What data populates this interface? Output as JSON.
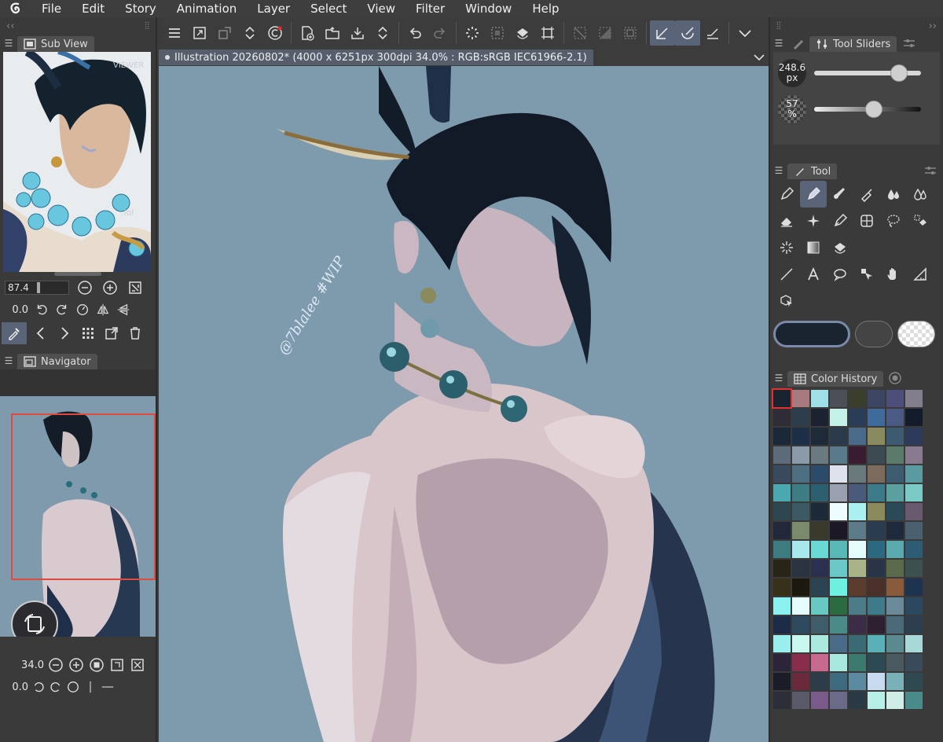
{
  "menu": {
    "items": [
      "File",
      "Edit",
      "Story",
      "Animation",
      "Layer",
      "Select",
      "View",
      "Filter",
      "Window",
      "Help"
    ]
  },
  "sub_view": {
    "title": "Sub View",
    "zoom": "87.4",
    "rotation": "0.0",
    "watermark_lines": [
      "VIEWER",
      ".lol"
    ]
  },
  "navigator": {
    "title": "Navigator",
    "zoom": "34.0",
    "rotation": "0.0"
  },
  "document": {
    "tab_label": "Illustration 20260802* (4000 x 6251px 300dpi 34.0% : RGB:sRGB IEC61966-2.1)"
  },
  "canvas": {
    "signature_text": "@7blalee #WIP"
  },
  "tool_sliders": {
    "title": "Tool Sliders",
    "size_value": "248.6",
    "size_unit": "px",
    "opacity_value": "57",
    "opacity_unit": "%",
    "size_level": 0.85,
    "opacity_level": 0.57
  },
  "tool": {
    "title": "Tool"
  },
  "color_history": {
    "title": "Color History",
    "colors": [
      "#1a2430",
      "#a77a80",
      "#9fe0e8",
      "#4a4f58",
      "#3a3f2c",
      "#3c4664",
      "#4d4f7a",
      "#827e8c",
      "#2f2c38",
      "#2e3d4c",
      "#1c2230",
      "#c4f2e8",
      "#2b3c58",
      "#3e6a9c",
      "#4a5a84",
      "#141c2c",
      "#1a2838",
      "#1c2e48",
      "#1e2a38",
      "#2a3a4c",
      "#4a6a8a",
      "#8a8a60",
      "#3c5a70",
      "#2e3a5c",
      "#5c6a7a",
      "#8a9aa8",
      "#6a7a80",
      "#587a8a",
      "#3a1c30",
      "#3c4a54",
      "#5a7a6a",
      "#8a7a90",
      "#3a4a5e",
      "#4e6f82",
      "#2c4a6a",
      "#dde2ec",
      "#6a7a7c",
      "#7c6a5c",
      "#3e5c70",
      "#5a9aa0",
      "#4aa8b0",
      "#3e7c84",
      "#2c6070",
      "#9aa0b0",
      "#4a5a7a",
      "#3c7a8a",
      "#5aa0a0",
      "#7acac8",
      "#2e4650",
      "#3c5a64",
      "#1c2a38",
      "#ecfcff",
      "#aaf0f0",
      "#8a8a5c",
      "#2a4a5a",
      "#6a5a70",
      "#22283a",
      "#7a8a6a",
      "#3a3a2c",
      "#1c1828",
      "#5c7a88",
      "#2a3c50",
      "#1e2a3c",
      "#4a6070",
      "#3c7c80",
      "#a8e8ec",
      "#6ad8d4",
      "#58b8b8",
      "#e4fcfc",
      "#2c6880",
      "#5aaab0",
      "#2e5c74",
      "#282418",
      "#2a3440",
      "#2c3050",
      "#6ac8c8",
      "#a8b488",
      "#2a3448",
      "#5a6a4a",
      "#3c5050",
      "#383018",
      "#1c1810",
      "#2a4454",
      "#6ef0e0",
      "#5c3c2c",
      "#4a3028",
      "#8a5a3c",
      "#1c3450",
      "#8af0f0",
      "#e4fcfc",
      "#68c8c4",
      "#2c6a40",
      "#4c7c88",
      "#3e7a8a",
      "#6a8a9a",
      "#2c4860",
      "#1c2c48",
      "#2e4a60",
      "#3e5c6a",
      "#4a8a88",
      "#3c2c48",
      "#2e2030",
      "#4a6a7a",
      "#2c3e50",
      "#9aeeee",
      "#c8f8f0",
      "#aae8e0",
      "#4a6a8a",
      "#3a6a74",
      "#5ab0b8",
      "#5a8a90",
      "#a8d8d8",
      "#2c2438",
      "#8a2c4c",
      "#c86a90",
      "#a8e8e0",
      "#3c7a70",
      "#2c4a54",
      "#4a5860",
      "#3a4a5a",
      "#1c1c28",
      "#6a2a3c",
      "#2c3c48",
      "#3e6a80",
      "#5c8aa0",
      "#c8daf0",
      "#7ab0b8",
      "#2e4a50",
      "#2c2e3a",
      "#5a5a6a",
      "#7a5a8a",
      "#6a6a8a",
      "#2a3a44",
      "#b8f0e8",
      "#cfeee8",
      "#4a8a8a"
    ]
  }
}
